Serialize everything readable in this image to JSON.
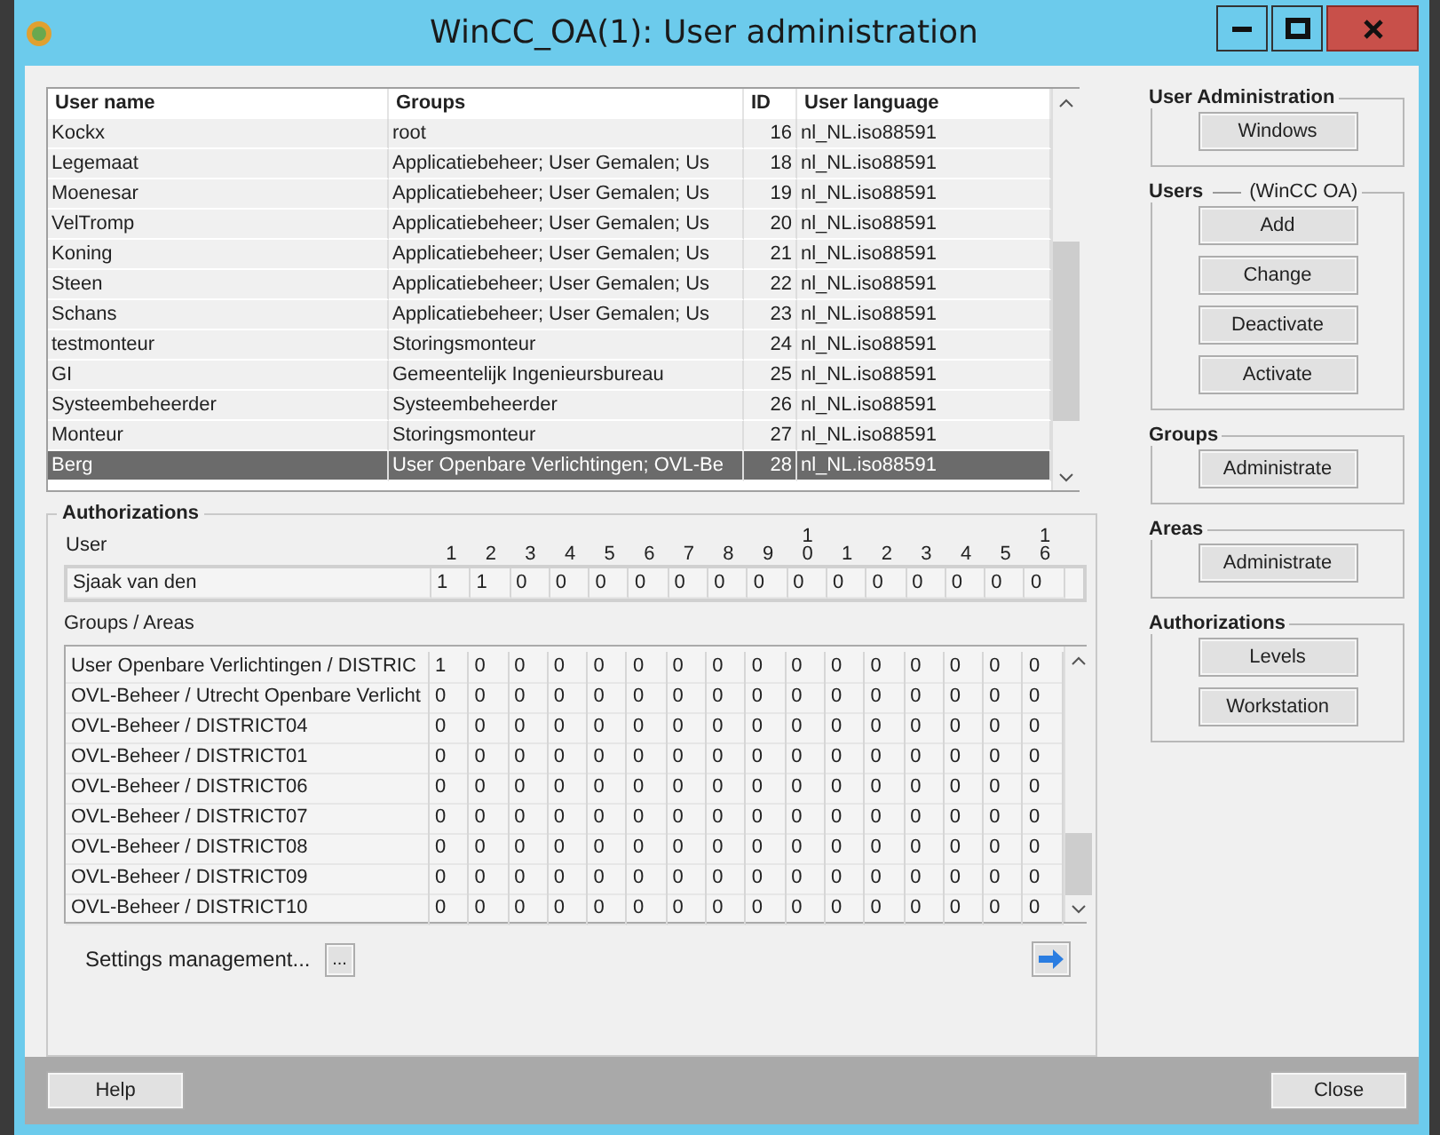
{
  "window": {
    "title": "WinCC_OA(1): User administration"
  },
  "users_table": {
    "columns": [
      "User name",
      "Groups",
      "ID",
      "User language"
    ],
    "rows": [
      {
        "cells": [
          "Kockx",
          "root",
          "16",
          "nl_NL.iso88591"
        ],
        "selected": false
      },
      {
        "cells": [
          "Legemaat",
          "Applicatiebeheer; User Gemalen; Us",
          "18",
          "nl_NL.iso88591"
        ],
        "selected": false
      },
      {
        "cells": [
          "Moenesar",
          "Applicatiebeheer; User Gemalen; Us",
          "19",
          "nl_NL.iso88591"
        ],
        "selected": false
      },
      {
        "cells": [
          "VelTromp",
          "Applicatiebeheer; User Gemalen; Us",
          "20",
          "nl_NL.iso88591"
        ],
        "selected": false
      },
      {
        "cells": [
          "Koning",
          "Applicatiebeheer; User Gemalen; Us",
          "21",
          "nl_NL.iso88591"
        ],
        "selected": false
      },
      {
        "cells": [
          "Steen",
          "Applicatiebeheer; User Gemalen; Us",
          "22",
          "nl_NL.iso88591"
        ],
        "selected": false
      },
      {
        "cells": [
          "Schans",
          "Applicatiebeheer; User Gemalen; Us",
          "23",
          "nl_NL.iso88591"
        ],
        "selected": false
      },
      {
        "cells": [
          "testmonteur",
          "Storingsmonteur",
          "24",
          "nl_NL.iso88591"
        ],
        "selected": false
      },
      {
        "cells": [
          "GI",
          "Gemeentelijk Ingenieursbureau",
          "25",
          "nl_NL.iso88591"
        ],
        "selected": false
      },
      {
        "cells": [
          "Systeembeheerder",
          "Systeembeheerder",
          "26",
          "nl_NL.iso88591"
        ],
        "selected": false
      },
      {
        "cells": [
          "Monteur",
          "Storingsmonteur",
          "27",
          "nl_NL.iso88591"
        ],
        "selected": false
      },
      {
        "cells": [
          "Berg",
          "User Openbare Verlichtingen; OVL-Be",
          "28",
          "nl_NL.iso88591"
        ],
        "selected": true
      }
    ]
  },
  "authorizations": {
    "title": "Authorizations",
    "user_label": "User",
    "level_headers": [
      "1",
      "2",
      "3",
      "4",
      "5",
      "6",
      "7",
      "8",
      "9",
      "10",
      "1",
      "2",
      "3",
      "4",
      "5",
      "16"
    ],
    "user_row": {
      "name": "Sjaak van den",
      "values": [
        "1",
        "1",
        "0",
        "0",
        "0",
        "0",
        "0",
        "0",
        "0",
        "0",
        "0",
        "0",
        "0",
        "0",
        "0",
        "0"
      ]
    },
    "groups_label": "Groups / Areas",
    "group_rows": [
      {
        "name": "User Openbare Verlichtingen / DISTRIC",
        "values": [
          "1",
          "0",
          "0",
          "0",
          "0",
          "0",
          "0",
          "0",
          "0",
          "0",
          "0",
          "0",
          "0",
          "0",
          "0",
          "0"
        ]
      },
      {
        "name": "OVL-Beheer / Utrecht Openbare Verlicht",
        "values": [
          "0",
          "0",
          "0",
          "0",
          "0",
          "0",
          "0",
          "0",
          "0",
          "0",
          "0",
          "0",
          "0",
          "0",
          "0",
          "0"
        ]
      },
      {
        "name": "OVL-Beheer / DISTRICT04",
        "values": [
          "0",
          "0",
          "0",
          "0",
          "0",
          "0",
          "0",
          "0",
          "0",
          "0",
          "0",
          "0",
          "0",
          "0",
          "0",
          "0"
        ]
      },
      {
        "name": "OVL-Beheer / DISTRICT01",
        "values": [
          "0",
          "0",
          "0",
          "0",
          "0",
          "0",
          "0",
          "0",
          "0",
          "0",
          "0",
          "0",
          "0",
          "0",
          "0",
          "0"
        ]
      },
      {
        "name": "OVL-Beheer / DISTRICT06",
        "values": [
          "0",
          "0",
          "0",
          "0",
          "0",
          "0",
          "0",
          "0",
          "0",
          "0",
          "0",
          "0",
          "0",
          "0",
          "0",
          "0"
        ]
      },
      {
        "name": "OVL-Beheer / DISTRICT07",
        "values": [
          "0",
          "0",
          "0",
          "0",
          "0",
          "0",
          "0",
          "0",
          "0",
          "0",
          "0",
          "0",
          "0",
          "0",
          "0",
          "0"
        ]
      },
      {
        "name": "OVL-Beheer / DISTRICT08",
        "values": [
          "0",
          "0",
          "0",
          "0",
          "0",
          "0",
          "0",
          "0",
          "0",
          "0",
          "0",
          "0",
          "0",
          "0",
          "0",
          "0"
        ]
      },
      {
        "name": "OVL-Beheer / DISTRICT09",
        "values": [
          "0",
          "0",
          "0",
          "0",
          "0",
          "0",
          "0",
          "0",
          "0",
          "0",
          "0",
          "0",
          "0",
          "0",
          "0",
          "0"
        ]
      },
      {
        "name": "OVL-Beheer / DISTRICT10",
        "values": [
          "0",
          "0",
          "0",
          "0",
          "0",
          "0",
          "0",
          "0",
          "0",
          "0",
          "0",
          "0",
          "0",
          "0",
          "0",
          "0"
        ]
      }
    ],
    "settings_label": "Settings management...",
    "settings_button": "..."
  },
  "right_panel": [
    {
      "title": "User Administration",
      "buttons": [
        "Windows"
      ]
    },
    {
      "title": "Users",
      "subtitle": "(WinCC OA)",
      "buttons": [
        "Add",
        "Change",
        "Deactivate",
        "Activate"
      ]
    },
    {
      "title": "Groups",
      "buttons": [
        "Administrate"
      ]
    },
    {
      "title": "Areas",
      "buttons": [
        "Administrate"
      ]
    },
    {
      "title": "Authorizations",
      "buttons": [
        "Levels",
        "Workstation"
      ]
    }
  ],
  "footer": {
    "buttons": [
      "Help",
      "Close"
    ]
  }
}
